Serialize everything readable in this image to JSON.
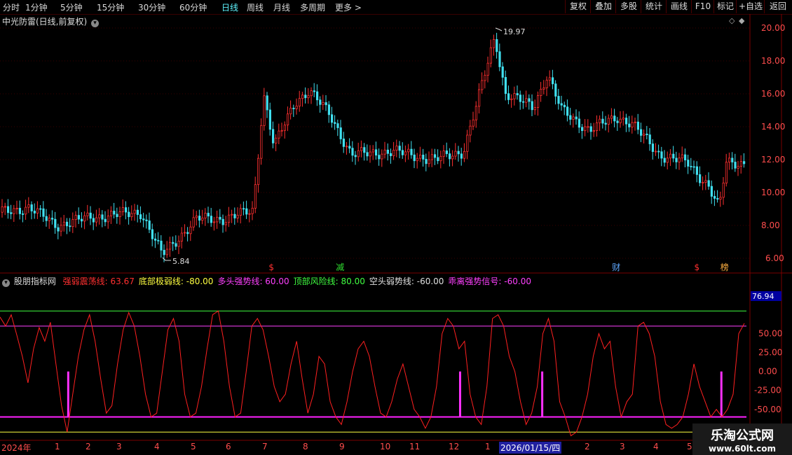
{
  "toolbar": {
    "timeframes": [
      "分时",
      "1分钟",
      "5分钟",
      "15分钟",
      "30分钟",
      "60分钟",
      "日线",
      "周线",
      "月线",
      "多周期",
      "更多 >"
    ],
    "active_timeframe": "日线",
    "right_buttons": [
      "复权",
      "叠加",
      "多股",
      "统计",
      "画线",
      "F10",
      "标记",
      "+自选",
      "返回"
    ]
  },
  "stock": {
    "title": "中光防雷(日线,前复权)",
    "high_label": "19.97",
    "low_label": "5.84"
  },
  "price_axis": [
    "20.00",
    "18.00",
    "16.00",
    "14.00",
    "12.00",
    "10.00",
    "8.00",
    "6.00"
  ],
  "event_markers": [
    {
      "text": "$",
      "color": "#ff3030",
      "date_index": 0.36
    },
    {
      "text": "减",
      "color": "#30e030",
      "date_index": 0.45
    },
    {
      "text": "财",
      "color": "#5fa8ff",
      "date_index": 0.82
    },
    {
      "text": "$",
      "color": "#ff3030",
      "date_index": 0.93
    },
    {
      "text": "榜",
      "color": "#ffb040",
      "date_index": 0.965
    }
  ],
  "indicator": {
    "name": "股朋指标网",
    "lines": [
      {
        "label": "强弱震荡线:",
        "value": "63.67",
        "color": "#ff3030"
      },
      {
        "label": "底部极弱线:",
        "value": "-80.00",
        "color": "#ffff40"
      },
      {
        "label": "多头强势线:",
        "value": "60.00",
        "color": "#ff40ff"
      },
      {
        "label": "顶部风险线:",
        "value": "80.00",
        "color": "#40ff40"
      },
      {
        "label": "空头弱势线:",
        "value": "-60.00",
        "color": "#e0e0e0"
      },
      {
        "label": "乖离强势信号:",
        "value": "-60.00",
        "color": "#ff40ff"
      }
    ],
    "current_value": "76.94",
    "axis": [
      "50.00",
      "25.00",
      "0.00",
      "-25.00",
      "-50.00"
    ]
  },
  "date_axis": {
    "labels": [
      "2024年",
      "1",
      "2",
      "3",
      "4",
      "5",
      "6",
      "7",
      "8",
      "9",
      "10",
      "11",
      "12",
      "1",
      "2",
      "3",
      "4",
      "5",
      "6"
    ],
    "highlight": "2026/01/15/四"
  },
  "watermark": {
    "line1": "乐淘公式网",
    "line2": "www.60lt.com"
  },
  "chart_data": {
    "type": "line",
    "series": [
      {
        "name": "强弱震荡线",
        "values": [
          72,
          60,
          75,
          48,
          20,
          -15,
          30,
          58,
          40,
          65,
          10,
          -45,
          -80,
          -30,
          20,
          55,
          75,
          40,
          -10,
          -55,
          -45,
          10,
          55,
          78,
          60,
          20,
          -30,
          -60,
          -55,
          0,
          55,
          70,
          40,
          -30,
          -60,
          -55,
          -20,
          30,
          75,
          80,
          40,
          -20,
          -60,
          -55,
          0,
          60,
          70,
          55,
          20,
          -20,
          -40,
          -30,
          10,
          40,
          -10,
          -55,
          -30,
          20,
          10,
          -40,
          -60,
          -70,
          -40,
          0,
          30,
          40,
          20,
          -20,
          -55,
          -60,
          -40,
          -10,
          10,
          -20,
          -50,
          -60,
          -75,
          -60,
          -20,
          50,
          70,
          60,
          30,
          40,
          -30,
          -60,
          -70,
          -20,
          70,
          75,
          60,
          20,
          0,
          -40,
          -70,
          -55,
          -20,
          50,
          70,
          40,
          -40,
          -60,
          -85,
          -80,
          -60,
          -30,
          20,
          50,
          30,
          40,
          -20,
          -60,
          -40,
          -30,
          60,
          65,
          50,
          20,
          -40,
          -70,
          -75,
          -70,
          -60,
          -30,
          10,
          -20,
          -40,
          -60,
          -50,
          -60,
          -50,
          -30,
          50,
          63.67
        ]
      }
    ],
    "reference_lines": [
      80,
      60,
      -60,
      -80
    ],
    "ylim": [
      -90,
      95
    ]
  }
}
